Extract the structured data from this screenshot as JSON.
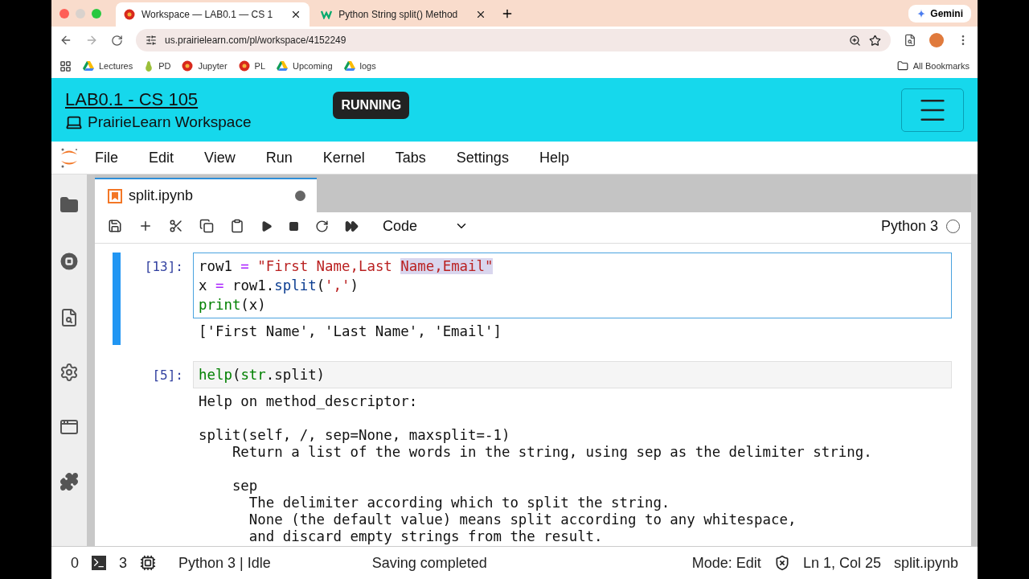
{
  "browser": {
    "tabs": [
      {
        "title": "Workspace — LAB0.1 — CS 1",
        "kind": "flower",
        "selected": true
      },
      {
        "title": "Python String split() Method",
        "kind": "w3",
        "selected": false
      }
    ],
    "gemini": "Gemini",
    "url": "us.prairielearn.com/pl/workspace/4152249",
    "bookmarks": [
      {
        "label": "Lectures",
        "kind": "drive"
      },
      {
        "label": "PD",
        "kind": "pear"
      },
      {
        "label": "Jupyter",
        "kind": "flower"
      },
      {
        "label": "PL",
        "kind": "flower"
      },
      {
        "label": "Upcoming",
        "kind": "drive"
      },
      {
        "label": "logs",
        "kind": "drive"
      }
    ],
    "all_bookmarks": "All Bookmarks"
  },
  "header": {
    "title": "LAB0.1 - CS 105",
    "subtitle": "PrairieLearn Workspace",
    "status": "RUNNING"
  },
  "menu": [
    "File",
    "Edit",
    "View",
    "Run",
    "Kernel",
    "Tabs",
    "Settings",
    "Help"
  ],
  "notebook_tab": {
    "title": "split.ipynb",
    "unsaved": true
  },
  "toolbar": {
    "cell_type": "Code",
    "kernel": "Python 3",
    "kernel_busy": false
  },
  "cells": [
    {
      "prompt": "[13]:",
      "active": true,
      "lines": [
        [
          {
            "text": "row1 ",
            "kind": "name",
            "selected": false
          },
          {
            "text": "=",
            "kind": "op",
            "selected": false
          },
          {
            "text": " \"First Name,Last ",
            "kind": "str",
            "selected": false
          },
          {
            "text": "Name,Email\"",
            "kind": "str",
            "selected": true
          }
        ],
        [
          {
            "text": "x ",
            "kind": "name",
            "selected": false
          },
          {
            "text": "=",
            "kind": "op",
            "selected": false
          },
          {
            "text": " row1.",
            "kind": "name",
            "selected": false
          },
          {
            "text": "split",
            "kind": "method",
            "selected": false
          },
          {
            "text": "(",
            "kind": "name",
            "selected": false
          },
          {
            "text": "','",
            "kind": "str",
            "selected": false
          },
          {
            "text": ")",
            "kind": "name",
            "selected": false
          }
        ],
        [
          {
            "text": "print",
            "kind": "builtin",
            "selected": false
          },
          {
            "text": "(x)",
            "kind": "name",
            "selected": false
          }
        ]
      ],
      "output": "['First Name', 'Last Name', 'Email']"
    },
    {
      "prompt": "[5]:",
      "active": false,
      "lines": [
        [
          {
            "text": "help",
            "kind": "builtin",
            "selected": false
          },
          {
            "text": "(",
            "kind": "name",
            "selected": false
          },
          {
            "text": "str",
            "kind": "builtin",
            "selected": false
          },
          {
            "text": ".split)",
            "kind": "name",
            "selected": false
          }
        ]
      ],
      "output": "Help on method_descriptor:\n\nsplit(self, /, sep=None, maxsplit=-1)\n    Return a list of the words in the string, using sep as the delimiter string.\n\n    sep\n      The delimiter according which to split the string.\n      None (the default value) means split according to any whitespace,\n      and discard empty strings from the result."
    }
  ],
  "status_bar": {
    "terminals": "0",
    "kernels": "3",
    "kernel_status": "Python 3 | Idle",
    "message": "Saving completed",
    "mode": "Mode: Edit",
    "position": "Ln 1, Col 25",
    "file": "split.ipynb"
  }
}
